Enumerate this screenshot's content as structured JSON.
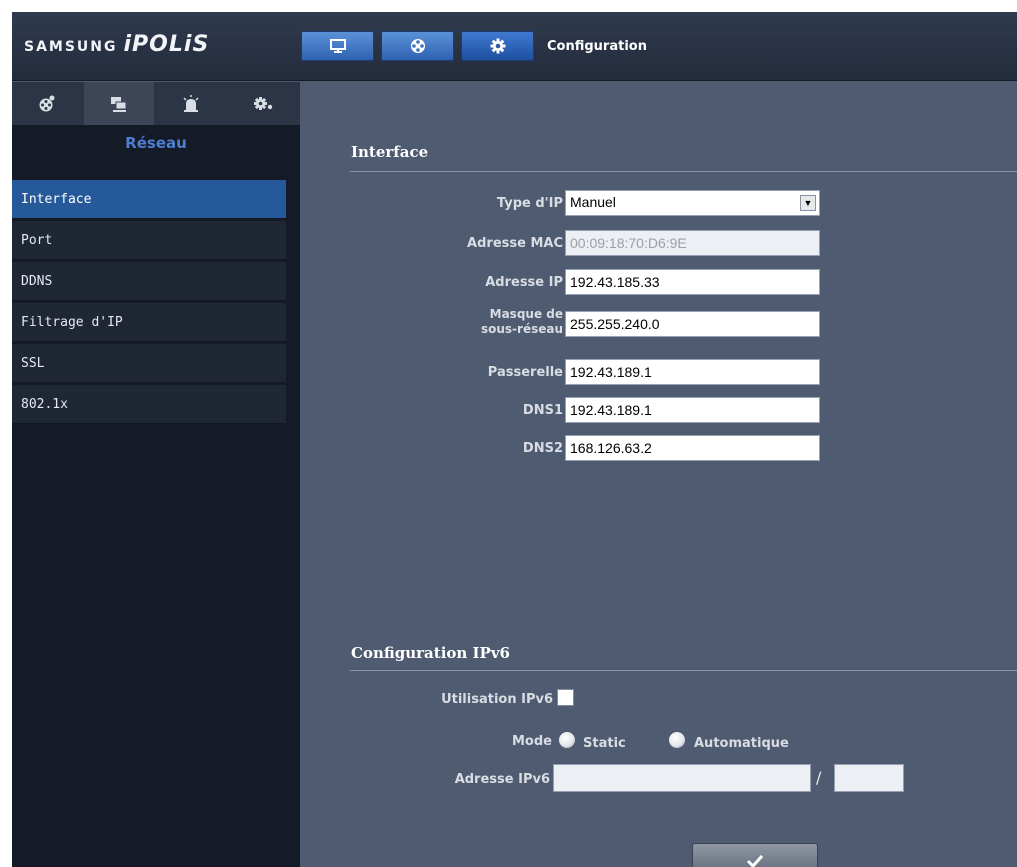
{
  "app": {
    "brand": "SAMSUNG",
    "product": "iPOLiS",
    "header_title": "Configuration",
    "top_buttons": [
      {
        "icon": "monitor-icon"
      },
      {
        "icon": "film-reel-icon"
      },
      {
        "icon": "gear-icon",
        "active": true
      }
    ]
  },
  "sidebar": {
    "tabs": [
      {
        "icon": "video-settings-icon"
      },
      {
        "icon": "network-icon",
        "active": true
      },
      {
        "icon": "alarm-icon"
      },
      {
        "icon": "system-settings-icon"
      }
    ],
    "heading": "Réseau",
    "items": [
      {
        "label": "Interface",
        "active": true
      },
      {
        "label": "Port"
      },
      {
        "label": "DDNS"
      },
      {
        "label": "Filtrage d'IP"
      },
      {
        "label": "SSL"
      },
      {
        "label": "802.1x"
      }
    ]
  },
  "interface": {
    "title": "Interface",
    "ip_type": {
      "label": "Type d'IP",
      "value": "Manuel"
    },
    "mac": {
      "label": "Adresse MAC",
      "value": "00:09:18:70:D6:9E"
    },
    "ip": {
      "label": "Adresse IP",
      "value": "192.43.185.33"
    },
    "mask": {
      "label_line1": "Masque de",
      "label_line2": "sous-réseau",
      "value": "255.255.240.0"
    },
    "gateway": {
      "label": "Passerelle",
      "value": "192.43.189.1"
    },
    "dns1": {
      "label": "DNS1",
      "value": "192.43.189.1"
    },
    "dns2": {
      "label": "DNS2",
      "value": "168.126.63.2"
    }
  },
  "ipv6": {
    "title": "Configuration IPv6",
    "use_label": "Utilisation IPv6",
    "use_checked": false,
    "mode_label": "Mode",
    "mode_static": "Static",
    "mode_auto": "Automatique",
    "address_label": "Adresse IPv6",
    "address_value": "",
    "separator": "/",
    "prefix_value": ""
  },
  "apply": {
    "icon": "checkmark-icon"
  }
}
